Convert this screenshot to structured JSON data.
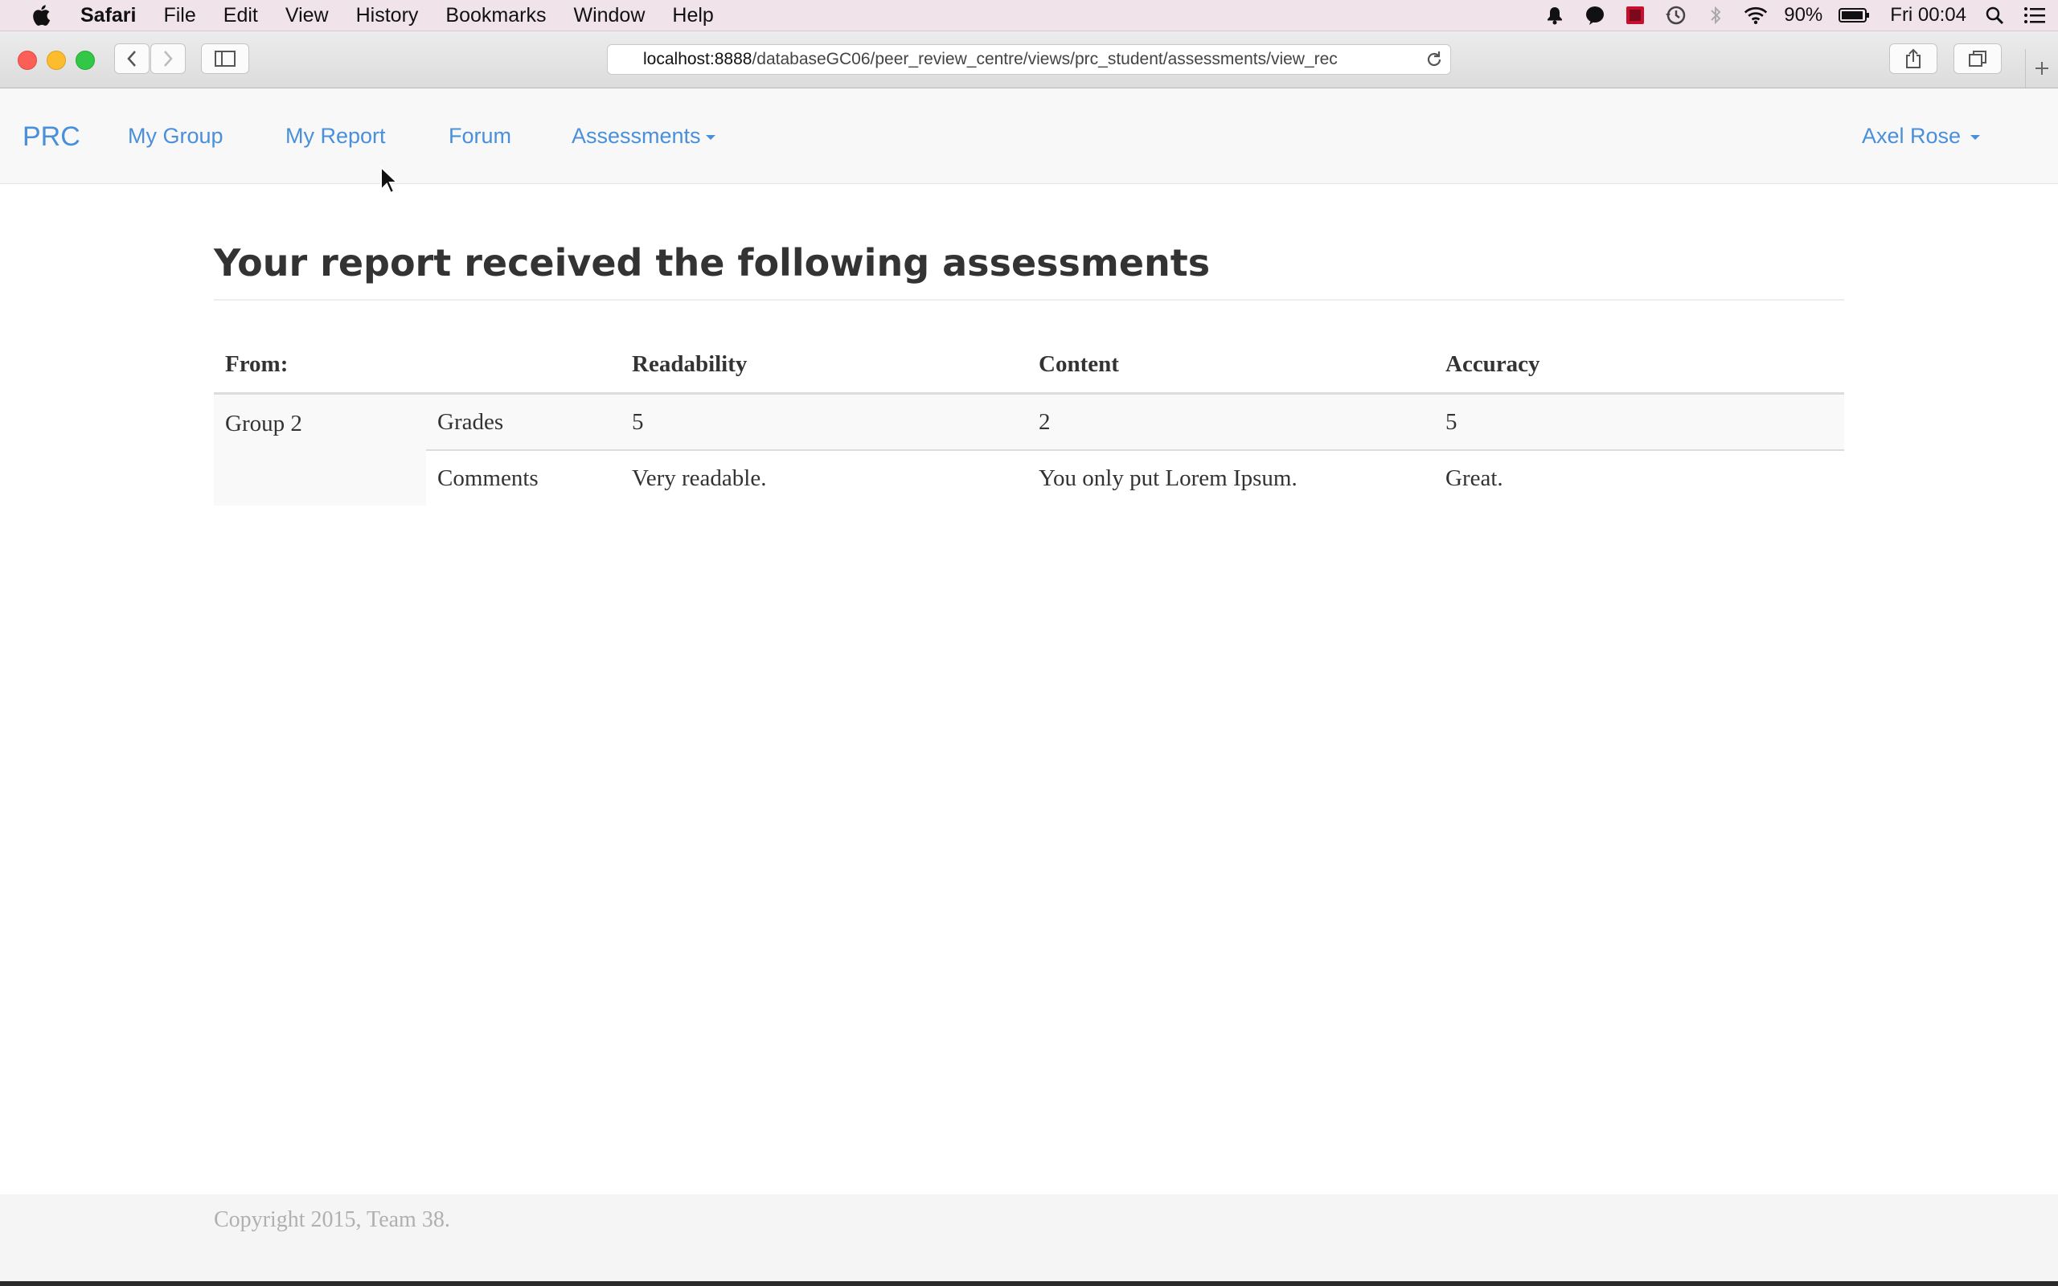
{
  "menubar": {
    "app_name": "Safari",
    "items": [
      "File",
      "Edit",
      "View",
      "History",
      "Bookmarks",
      "Window",
      "Help"
    ],
    "battery": "90%",
    "clock": "Fri 00:04"
  },
  "browser": {
    "url_host": "localhost:8888",
    "url_path": "/databaseGC06/peer_review_centre/views/prc_student/assessments/view_rec"
  },
  "nav": {
    "brand": "PRC",
    "links": [
      "My Group",
      "My Report",
      "Forum",
      "Assessments"
    ],
    "user": "Axel Rose"
  },
  "main": {
    "title": "Your report received the following assessments",
    "table": {
      "headers": [
        "From:",
        "",
        "Readability",
        "Content",
        "Accuracy"
      ],
      "group": "Group 2",
      "rows": [
        {
          "label": "Grades",
          "readability": "5",
          "content": "2",
          "accuracy": "5"
        },
        {
          "label": "Comments",
          "readability": "Very readable.",
          "content": "You only put Lorem Ipsum.",
          "accuracy": "Great."
        }
      ]
    }
  },
  "footer": {
    "copyright": "Copyright 2015, Team 38."
  },
  "colors": {
    "link": "#4a8fd9",
    "menubar": "#f1e3ea"
  }
}
